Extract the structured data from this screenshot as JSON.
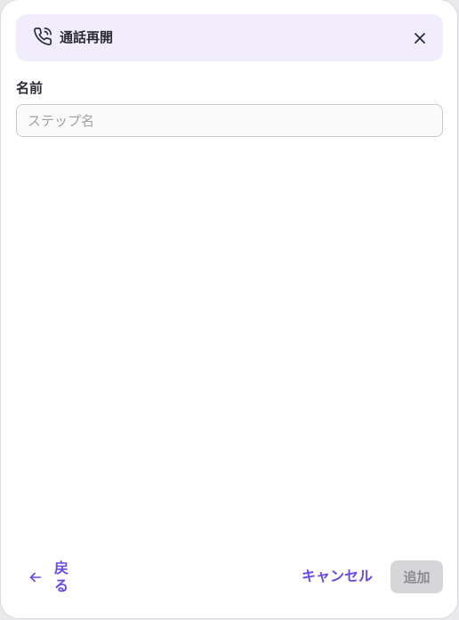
{
  "header": {
    "icon": "phone-call-icon",
    "title": "通話再開",
    "close_icon": "close-icon"
  },
  "form": {
    "name_label": "名前",
    "name_value": "",
    "name_placeholder": "ステップ名"
  },
  "footer": {
    "back_label": "戻る",
    "back_icon": "arrow-left-icon",
    "cancel_label": "キャンセル",
    "add_label": "追加",
    "add_disabled": true
  },
  "colors": {
    "accent": "#6a4ae0",
    "header_bg": "#f1edfc",
    "disabled_bg": "#d6d6d9"
  }
}
